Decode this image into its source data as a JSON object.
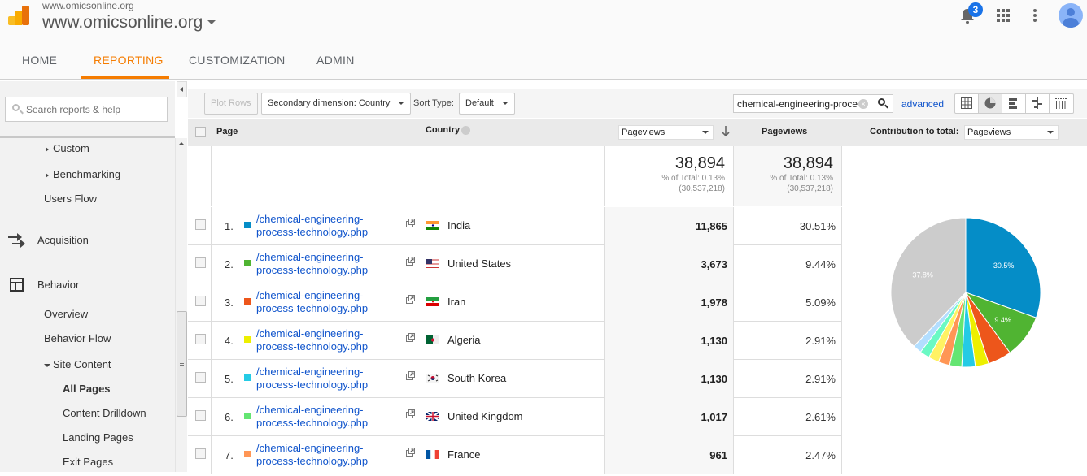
{
  "header": {
    "account_small": "www.omicsonline.org",
    "account_big": "www.omicsonline.org",
    "notification_count": "3"
  },
  "nav": {
    "tabs": [
      {
        "label": "HOME",
        "active": false
      },
      {
        "label": "REPORTING",
        "active": true
      },
      {
        "label": "CUSTOMIZATION",
        "active": false
      },
      {
        "label": "ADMIN",
        "active": false
      }
    ]
  },
  "sidebar": {
    "search_placeholder": "Search reports & help",
    "items": [
      {
        "label": "Custom",
        "level": 2,
        "expander": "collapsed"
      },
      {
        "label": "Benchmarking",
        "level": 2,
        "expander": "collapsed"
      },
      {
        "label": "Users Flow",
        "level": 2
      },
      {
        "label": "Acquisition",
        "level": 1,
        "icon": "acquisition-icon"
      },
      {
        "label": "Behavior",
        "level": 1,
        "icon": "behavior-icon"
      },
      {
        "label": "Overview",
        "level": 2
      },
      {
        "label": "Behavior Flow",
        "level": 2
      },
      {
        "label": "Site Content",
        "level": 2,
        "expander": "expanded"
      },
      {
        "label": "All Pages",
        "level": 3,
        "selected": true
      },
      {
        "label": "Content Drilldown",
        "level": 3
      },
      {
        "label": "Landing Pages",
        "level": 3
      },
      {
        "label": "Exit Pages",
        "level": 3
      }
    ]
  },
  "toolbar": {
    "plot_rows": "Plot Rows",
    "secondary_dimension": "Secondary dimension: Country",
    "sort_type_label": "Sort Type:",
    "sort_type_value": "Default",
    "filter_value": "chemical-engineering-proce",
    "advanced": "advanced",
    "views": [
      "table-view-icon",
      "pie-view-icon",
      "bar-view-icon",
      "comparison-view-icon",
      "pivot-view-icon"
    ],
    "active_view": "pie-view-icon"
  },
  "table": {
    "headers": {
      "page": "Page",
      "country": "Country",
      "metric_select": "Pageviews",
      "metric": "Pageviews",
      "contribution_label": "Contribution to total:",
      "contribution_select": "Pageviews"
    },
    "summary": {
      "value": "38,894",
      "pct_of_total": "% of Total: 0.13%",
      "total": "(30,537,218)",
      "value2": "38,894",
      "pct_of_total2": "% of Total: 0.13%",
      "total2": "(30,537,218)"
    },
    "rows": [
      {
        "num": "1.",
        "color": "#058dc7",
        "page": "/chemical-engineering-process-technology.php",
        "country": "India",
        "pageviews": "11,865",
        "pct": "30.51%"
      },
      {
        "num": "2.",
        "color": "#50b432",
        "page": "/chemical-engineering-process-technology.php",
        "country": "United States",
        "pageviews": "3,673",
        "pct": "9.44%"
      },
      {
        "num": "3.",
        "color": "#ed561b",
        "page": "/chemical-engineering-process-technology.php",
        "country": "Iran",
        "pageviews": "1,978",
        "pct": "5.09%"
      },
      {
        "num": "4.",
        "color": "#edef00",
        "page": "/chemical-engineering-process-technology.php",
        "country": "Algeria",
        "pageviews": "1,130",
        "pct": "2.91%"
      },
      {
        "num": "5.",
        "color": "#24cbe5",
        "page": "/chemical-engineering-process-technology.php",
        "country": "South Korea",
        "pageviews": "1,130",
        "pct": "2.91%"
      },
      {
        "num": "6.",
        "color": "#64e572",
        "page": "/chemical-engineering-process-technology.php",
        "country": "United Kingdom",
        "pageviews": "1,017",
        "pct": "2.61%"
      },
      {
        "num": "7.",
        "color": "#ff9655",
        "page": "/chemical-engineering-process-technology.php",
        "country": "France",
        "pageviews": "961",
        "pct": "2.47%"
      }
    ]
  },
  "chart_data": {
    "type": "pie",
    "title": "Contribution to total: Pageviews",
    "slices": [
      {
        "label": "India",
        "value": 30.51,
        "color": "#058dc7",
        "data_label": "30.5%"
      },
      {
        "label": "United States",
        "value": 9.44,
        "color": "#50b432",
        "data_label": "9.4%"
      },
      {
        "label": "Iran",
        "value": 5.09,
        "color": "#ed561b"
      },
      {
        "label": "Algeria",
        "value": 2.91,
        "color": "#edef00"
      },
      {
        "label": "South Korea",
        "value": 2.91,
        "color": "#24cbe5"
      },
      {
        "label": "United Kingdom",
        "value": 2.61,
        "color": "#64e572"
      },
      {
        "label": "France",
        "value": 2.47,
        "color": "#ff9655"
      },
      {
        "label": "Row 8",
        "value": 2.3,
        "color": "#fff263"
      },
      {
        "label": "Row 9",
        "value": 2.1,
        "color": "#6af9c4"
      },
      {
        "label": "Row 10",
        "value": 1.86,
        "color": "#b2deff"
      },
      {
        "label": "Other",
        "value": 37.8,
        "color": "#cccccc",
        "data_label": "37.8%"
      }
    ]
  }
}
